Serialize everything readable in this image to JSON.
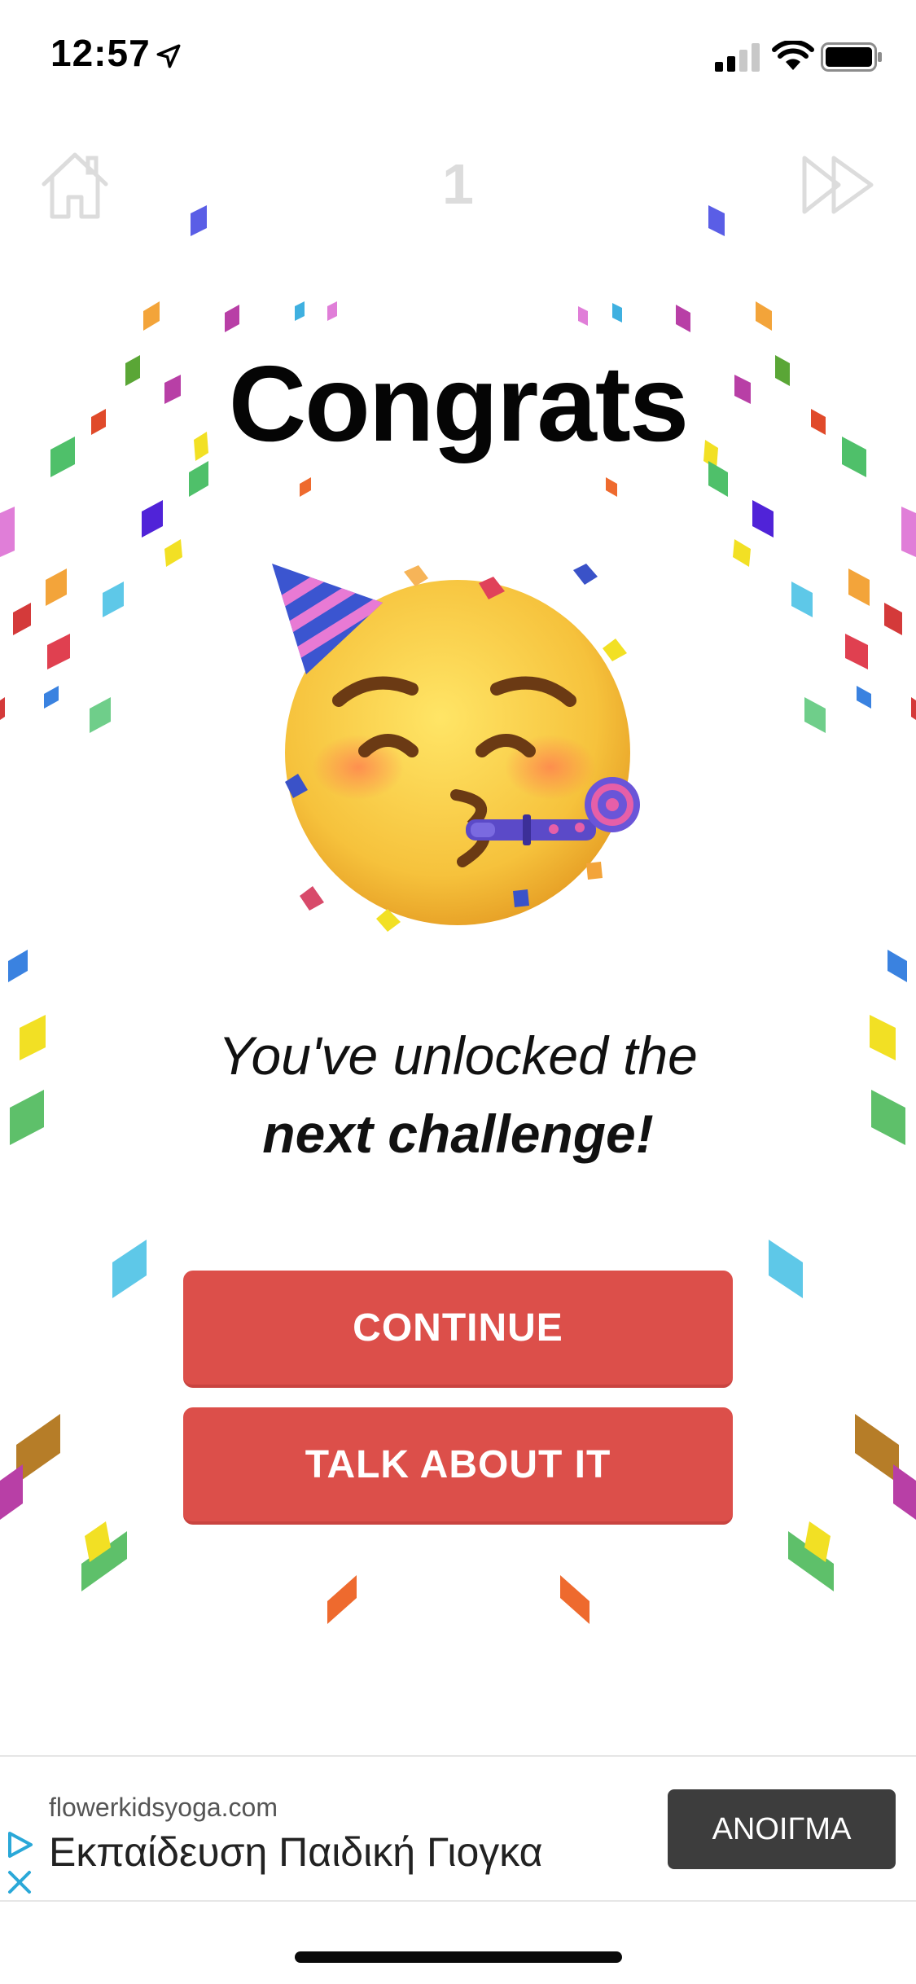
{
  "status_bar": {
    "time": "12:57"
  },
  "nav": {
    "level": "1"
  },
  "main": {
    "title": "Congrats",
    "message_line1": "You've unlocked the",
    "message_line2": "next challenge!"
  },
  "buttons": {
    "continue_label": "CONTINUE",
    "talk_label": "TALK ABOUT IT"
  },
  "ad": {
    "domain": "flowerkidsyoga.com",
    "headline": "Εκπαίδευση Παιδική Γιογκα",
    "cta_label": "ΑΝΟΙΓΜΑ"
  },
  "colors": {
    "button": "#dc4f4a",
    "ad_button": "#3d3d3d",
    "nav_icons": "#dcdcdc"
  },
  "icons": {
    "home": "home-icon",
    "skip": "fast-forward-icon",
    "location": "location-arrow-icon",
    "signal": "cellular-signal-icon",
    "wifi": "wifi-icon",
    "battery": "battery-icon",
    "ad_choices": "ad-choices-icon",
    "ad_close": "close-icon"
  }
}
